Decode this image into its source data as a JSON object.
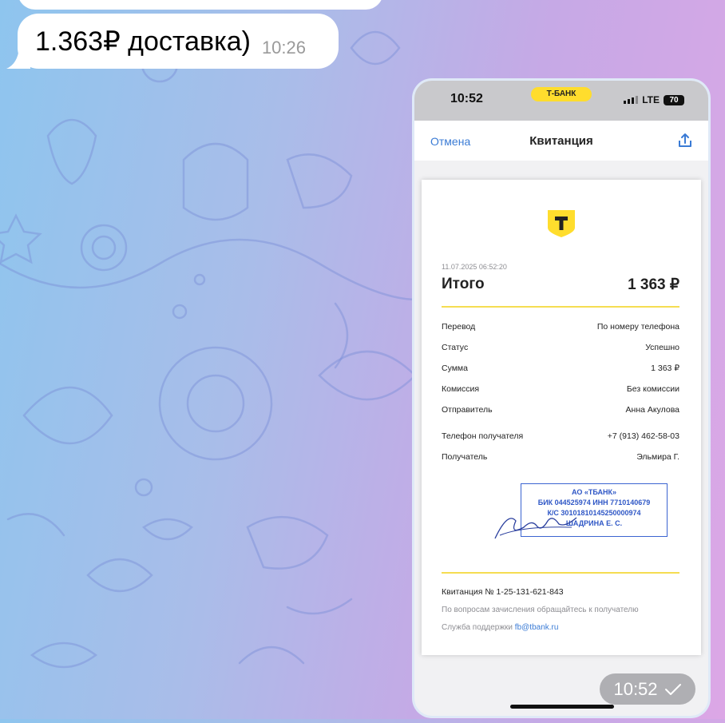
{
  "chat": {
    "message_text": "1.363₽ доставка)",
    "message_time": "10:26",
    "photo_time": "10:52"
  },
  "phone": {
    "status_time": "10:52",
    "carrier_pill": "Т-БАНК",
    "network": "LTE",
    "battery": "70"
  },
  "nav": {
    "cancel_label": "Отмена",
    "title": "Квитанция"
  },
  "receipt": {
    "datetime": "11.07.2025 06:52:20",
    "total_label": "Итого",
    "total_value": "1 363 ₽",
    "rows": [
      {
        "label": "Перевод",
        "value": "По номеру телефона"
      },
      {
        "label": "Статус",
        "value": "Успешно"
      },
      {
        "label": "Сумма",
        "value": "1 363 ₽"
      },
      {
        "label": "Комиссия",
        "value": "Без комиссии"
      },
      {
        "label": "Отправитель",
        "value": "Анна Акулова"
      },
      {
        "label": "Телефон получателя",
        "value": "+7 (913) 462-58-03"
      },
      {
        "label": "Получатель",
        "value": "Эльмира Г."
      }
    ],
    "stamp": [
      "АО «ТБАНК»",
      "БИК 044525974 ИНН 7710140679",
      "К/С 30101810145250000974",
      "ШАДРИНА Е. С."
    ],
    "receipt_number": "Квитанция  № 1-25-131-621-843",
    "note": "По вопросам зачисления обращайтесь к получателю",
    "support_label": "Служба поддержки ",
    "support_email": "fb@tbank.ru"
  },
  "colors": {
    "brand_yellow": "#ffdd2d",
    "link_blue": "#3a7bd5",
    "stamp_blue": "#2f57c6"
  }
}
